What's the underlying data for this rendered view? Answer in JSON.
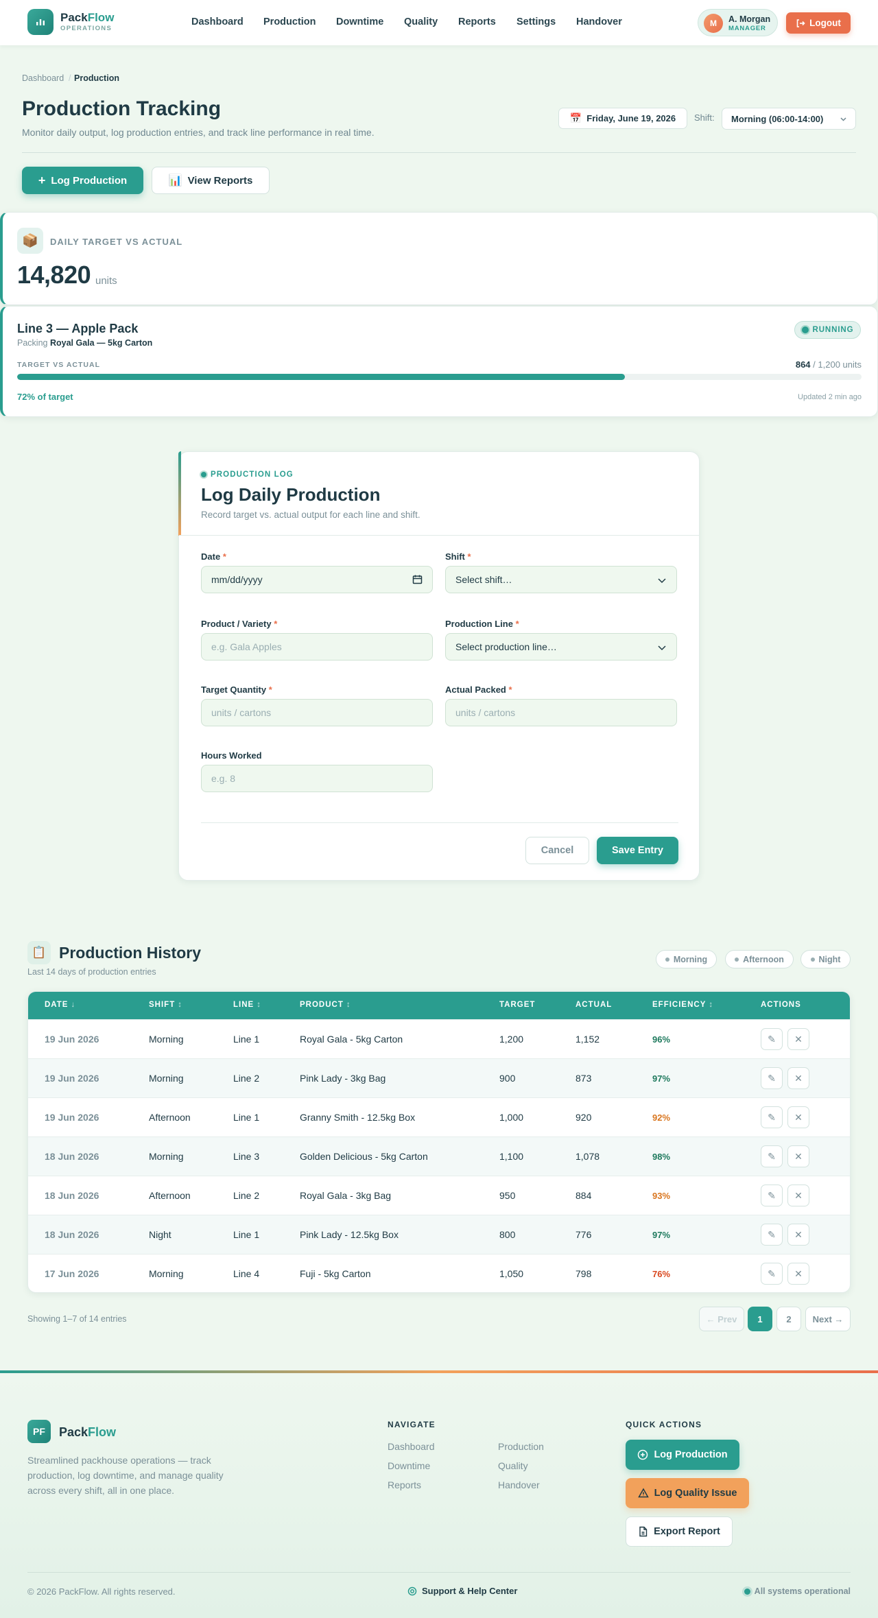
{
  "brand": {
    "name_a": "Pack",
    "name_b": "Flow",
    "tagline": "OPERATIONS",
    "initials": "PF"
  },
  "nav": {
    "items": [
      "Dashboard",
      "Production",
      "Downtime",
      "Quality",
      "Reports",
      "Settings",
      "Handover"
    ]
  },
  "user": {
    "initial": "M",
    "name": "A. Morgan",
    "role": "MANAGER",
    "logout_label": "Logout"
  },
  "breadcrumb": {
    "root": "Dashboard",
    "current": "Production"
  },
  "page": {
    "title": "Production Tracking",
    "subtitle": "Monitor daily output, log production entries, and track line performance in real time.",
    "date": "Friday, June 19, 2026",
    "shift_label": "Shift:",
    "shift_value": "Morning (06:00-14:00)",
    "log_button": "Log Production",
    "reports_button": "View Reports"
  },
  "stat": {
    "label": "DAILY TARGET VS ACTUAL",
    "value": "14,820",
    "unit": "units"
  },
  "line": {
    "title": "Line 3 — Apple Pack",
    "packing_prefix": "Packing",
    "packing_item": "Royal Gala — 5kg Carton",
    "status": "RUNNING",
    "tva_label": "TARGET VS ACTUAL",
    "actual": "864",
    "target_text": "/ 1,200 units",
    "progress_fraction": 0.72,
    "pct_text": "72% of target",
    "updated": "Updated 2 min ago"
  },
  "form": {
    "tag": "PRODUCTION LOG",
    "title": "Log Daily Production",
    "subtitle": "Record target vs. actual output for each line and shift.",
    "date_label": "Date",
    "date_placeholder": "mm/dd/yyyy",
    "shift_label": "Shift",
    "shift_placeholder": "Select shift…",
    "product_label": "Product / Variety",
    "product_placeholder": "e.g. Gala Apples",
    "line_label": "Production Line",
    "line_placeholder": "Select production line…",
    "target_label": "Target Quantity",
    "target_placeholder": "units / cartons",
    "actual_label": "Actual Packed",
    "actual_placeholder": "units / cartons",
    "hours_label": "Hours Worked",
    "hours_placeholder": "e.g. 8",
    "cancel": "Cancel",
    "save": "Save Entry"
  },
  "history": {
    "title": "Production History",
    "subtitle": "Last 14 days of production entries",
    "filters": [
      "Morning",
      "Afternoon",
      "Night"
    ],
    "columns": [
      "DATE",
      "SHIFT",
      "LINE",
      "PRODUCT",
      "TARGET",
      "ACTUAL",
      "EFFICIENCY",
      "ACTIONS"
    ],
    "rows": [
      {
        "date": "19 Jun 2026",
        "shift": "Morning",
        "line": "Line 1",
        "product": "Royal Gala - 5kg Carton",
        "target": "1,200",
        "actual": "1,152",
        "eff": "96%",
        "eff_color": "#1f7a5e"
      },
      {
        "date": "19 Jun 2026",
        "shift": "Morning",
        "line": "Line 2",
        "product": "Pink Lady - 3kg Bag",
        "target": "900",
        "actual": "873",
        "eff": "97%",
        "eff_color": "#1f7a5e"
      },
      {
        "date": "19 Jun 2026",
        "shift": "Afternoon",
        "line": "Line 1",
        "product": "Granny Smith - 12.5kg Box",
        "target": "1,000",
        "actual": "920",
        "eff": "92%",
        "eff_color": "#d9761f"
      },
      {
        "date": "18 Jun 2026",
        "shift": "Morning",
        "line": "Line 3",
        "product": "Golden Delicious - 5kg Carton",
        "target": "1,100",
        "actual": "1,078",
        "eff": "98%",
        "eff_color": "#1f7a5e"
      },
      {
        "date": "18 Jun 2026",
        "shift": "Afternoon",
        "line": "Line 2",
        "product": "Royal Gala - 3kg Bag",
        "target": "950",
        "actual": "884",
        "eff": "93%",
        "eff_color": "#d9761f"
      },
      {
        "date": "18 Jun 2026",
        "shift": "Night",
        "line": "Line 1",
        "product": "Pink Lady - 12.5kg Box",
        "target": "800",
        "actual": "776",
        "eff": "97%",
        "eff_color": "#1f7a5e"
      },
      {
        "date": "17 Jun 2026",
        "shift": "Morning",
        "line": "Line 4",
        "product": "Fuji - 5kg Carton",
        "target": "1,050",
        "actual": "798",
        "eff": "76%",
        "eff_color": "#d9481f"
      }
    ],
    "showing": "Showing 1–7 of 14 entries",
    "prev": "← Prev",
    "pages": [
      "1",
      "2"
    ],
    "next": "Next →"
  },
  "footer": {
    "description": "Streamlined packhouse operations — track production, log downtime, and manage quality across every shift, all in one place.",
    "navigate_heading": "NAVIGATE",
    "nav_links": [
      "Dashboard",
      "Production",
      "Downtime",
      "Quality",
      "Reports",
      "Handover"
    ],
    "quick_heading": "QUICK ACTIONS",
    "quick_actions": [
      "Log Production",
      "Log Quality Issue",
      "Export Report"
    ],
    "copyright": "© 2026 PackFlow. All rights reserved.",
    "help": "Support & Help Center",
    "status": "All systems operational"
  },
  "colors": {
    "accent": "#2a9d8f",
    "warm": "#f2a15b",
    "danger": "#e96f4b"
  }
}
